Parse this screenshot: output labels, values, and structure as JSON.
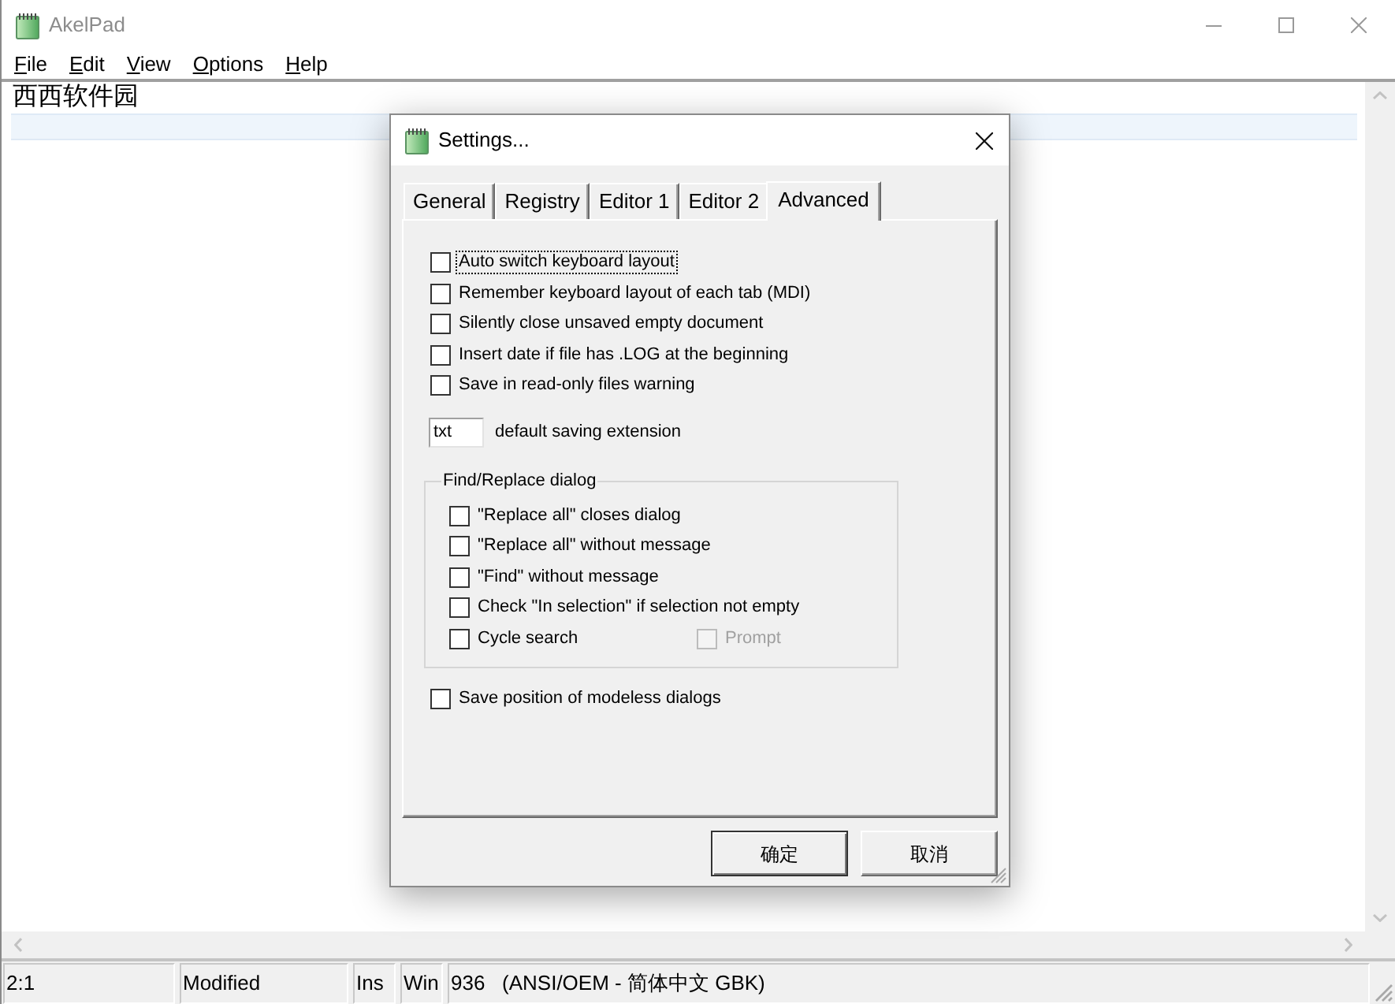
{
  "window": {
    "title": "AkelPad"
  },
  "menu": [
    {
      "label": "File"
    },
    {
      "label": "Edit"
    },
    {
      "label": "View"
    },
    {
      "label": "Options"
    },
    {
      "label": "Help"
    }
  ],
  "editor": {
    "text": "西西软件园"
  },
  "dialog": {
    "title": "Settings...",
    "tabs": [
      {
        "label": "General",
        "selected": false
      },
      {
        "label": "Registry",
        "selected": false
      },
      {
        "label": "Editor 1",
        "selected": false
      },
      {
        "label": "Editor 2",
        "selected": false
      },
      {
        "label": "Advanced",
        "selected": true
      }
    ],
    "options": [
      {
        "label": "Auto switch keyboard layout",
        "checked": false,
        "focused": true
      },
      {
        "label": "Remember keyboard layout of each tab (MDI)",
        "checked": false,
        "focused": false
      },
      {
        "label": "Silently close unsaved empty document",
        "checked": false,
        "focused": false
      },
      {
        "label": "Insert date if file has .LOG at the beginning",
        "checked": false,
        "focused": false
      },
      {
        "label": "Save in read-only files warning",
        "checked": false,
        "focused": false
      }
    ],
    "extension": {
      "value": "txt",
      "label": "default saving extension"
    },
    "find_replace": {
      "title": "Find/Replace dialog",
      "options": [
        {
          "label": "\"Replace all\" closes dialog",
          "checked": false,
          "disabled": false
        },
        {
          "label": "\"Replace all\" without message",
          "checked": false,
          "disabled": false
        },
        {
          "label": "\"Find\" without message",
          "checked": false,
          "disabled": false
        },
        {
          "label": "Check \"In selection\" if selection not empty",
          "checked": false,
          "disabled": false
        },
        {
          "label": "Cycle search",
          "checked": false,
          "disabled": false,
          "sub_option": {
            "label": "Prompt",
            "checked": false,
            "disabled": true
          }
        }
      ]
    },
    "bottom_options": [
      {
        "label": "Save position of modeless dialogs",
        "checked": false,
        "focused": false
      }
    ],
    "buttons": [
      {
        "label": "确定",
        "default": true
      },
      {
        "label": "取消",
        "default": false
      }
    ]
  },
  "status_bar": [
    {
      "text": "2:1"
    },
    {
      "text": "Modified"
    },
    {
      "text": "Ins"
    },
    {
      "text": "Win"
    },
    {
      "text": "936   (ANSI/OEM - 简体中文 GBK)"
    }
  ]
}
